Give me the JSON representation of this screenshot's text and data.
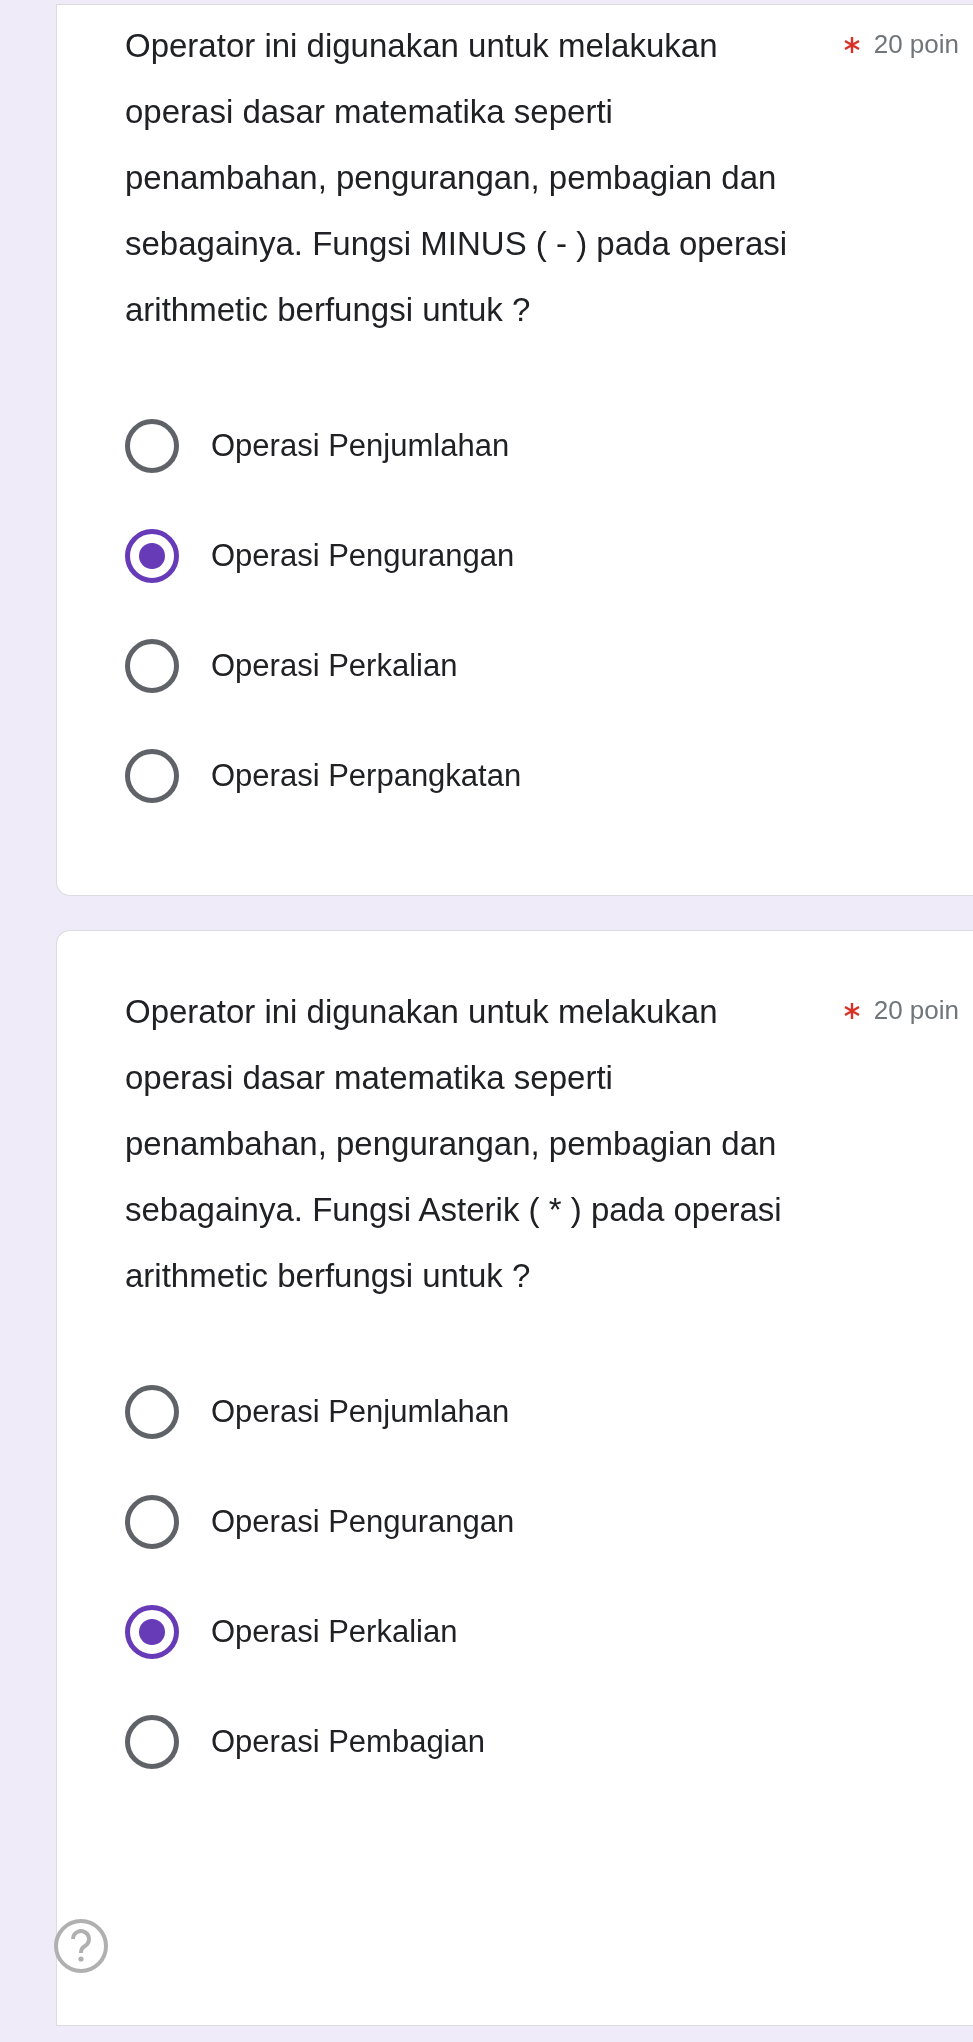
{
  "questions": [
    {
      "text": "Operator ini digunakan untuk melakukan operasi dasar matematika seperti penambahan, pengurangan, pembagian dan sebagainya. Fungsi MINUS ( - ) pada operasi arithmetic berfungsi untuk ?",
      "required": true,
      "points": "20 poin",
      "options": [
        {
          "label": "Operasi Penjumlahan",
          "selected": false
        },
        {
          "label": "Operasi Pengurangan",
          "selected": true
        },
        {
          "label": "Operasi Perkalian",
          "selected": false
        },
        {
          "label": "Operasi Perpangkatan",
          "selected": false
        }
      ]
    },
    {
      "text": "Operator ini digunakan untuk melakukan operasi dasar matematika seperti penambahan, pengurangan, pembagian dan sebagainya. Fungsi Asterik ( * ) pada operasi arithmetic berfungsi untuk ?",
      "required": true,
      "points": "20 poin",
      "options": [
        {
          "label": "Operasi Penjumlahan",
          "selected": false
        },
        {
          "label": "Operasi Pengurangan",
          "selected": false
        },
        {
          "label": "Operasi Perkalian",
          "selected": true
        },
        {
          "label": "Operasi Pembagian",
          "selected": false
        }
      ]
    }
  ]
}
